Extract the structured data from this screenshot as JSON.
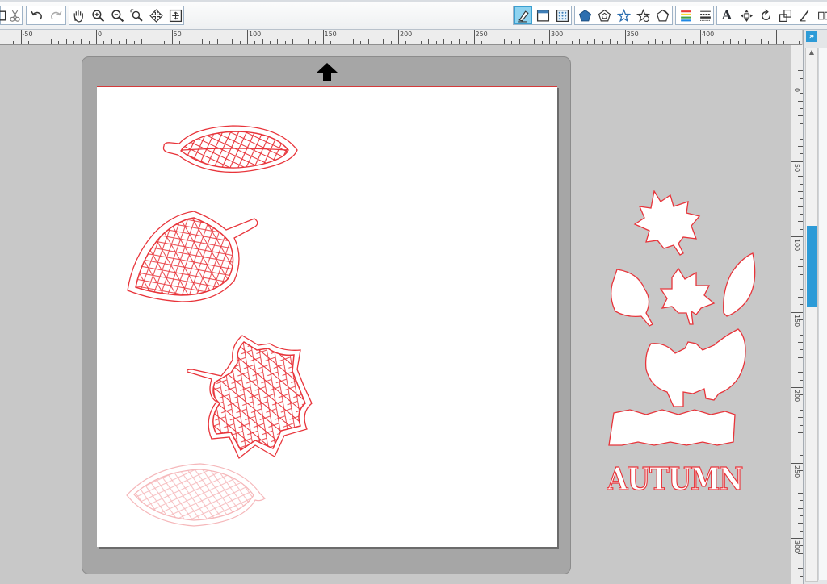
{
  "toolbar": {
    "groups": [
      {
        "name": "edit-tools",
        "items": [
          "copy-icon",
          "cut-icon"
        ]
      },
      {
        "name": "history-tools",
        "items": [
          "undo-icon",
          "redo-icon"
        ]
      },
      {
        "name": "view-tools",
        "items": [
          "pan-hand-icon",
          "zoom-in-icon",
          "zoom-out-icon",
          "zoom-select-icon",
          "move-view-icon",
          "fit-page-icon"
        ]
      },
      {
        "name": "panel-tools",
        "items": [
          "design-page-settings-icon",
          "page-view-icon",
          "fill-pattern-icon"
        ]
      },
      {
        "name": "shape-tools",
        "items": [
          "pentagon-icon",
          "pentagon-outline-icon",
          "star-outline-icon",
          "star-badge-icon",
          "shape-edit-icon"
        ]
      },
      {
        "name": "line-tools",
        "items": [
          "line-color-icon",
          "line-style-icon"
        ]
      },
      {
        "name": "text-tools",
        "items": [
          "text-style-icon",
          "transform-icon",
          "rotate-icon",
          "scale-icon",
          "eraser-icon",
          "align-icon"
        ]
      }
    ],
    "text_style_glyph": "A",
    "active_tool": "design-page-settings-icon"
  },
  "rulers": {
    "horizontal": [
      "-50",
      "0",
      "50",
      "100",
      "150",
      "200",
      "250",
      "300",
      "350",
      "400"
    ],
    "vertical": [
      "0",
      "50",
      "100",
      "150",
      "200",
      "250",
      "300"
    ]
  },
  "side_panel": {
    "toggle_label": "»",
    "scroll_up_label": "▲"
  },
  "canvas": {
    "page_color": "#ffffff",
    "cut_line_color": "#e8343a",
    "mat_color": "#a6a6a6",
    "workspace_color": "#c8c8c8",
    "autumn_word": "AUTUMN"
  },
  "colors": {
    "accent": "#2d9bd7",
    "active_tool_bg": "#8ed3f0"
  }
}
